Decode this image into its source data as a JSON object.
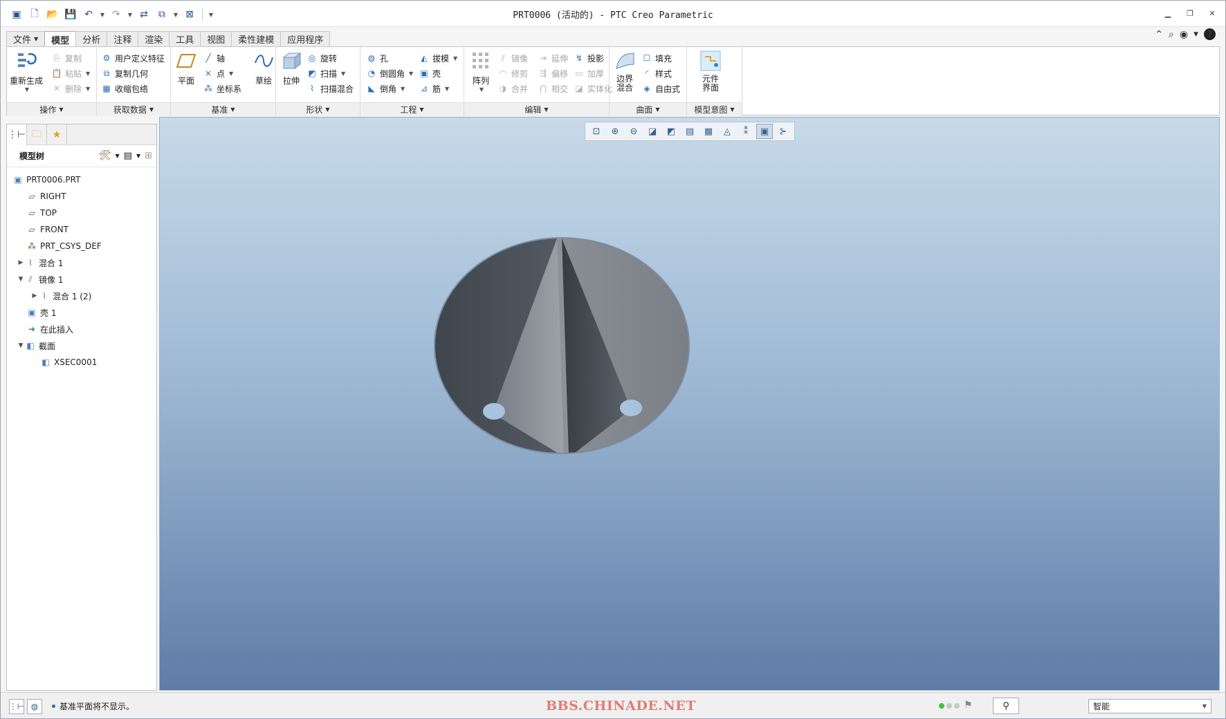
{
  "window": {
    "title": "PRT0006 (活动的) - PTC Creo Parametric"
  },
  "tabs": [
    {
      "label": "文件",
      "dropdown": true
    },
    {
      "label": "模型",
      "active": true
    },
    {
      "label": "分析"
    },
    {
      "label": "注释"
    },
    {
      "label": "渲染"
    },
    {
      "label": "工具"
    },
    {
      "label": "视图"
    },
    {
      "label": "柔性建模"
    },
    {
      "label": "应用程序"
    }
  ],
  "ribbon": {
    "operations": {
      "label": "操作",
      "regenerate": "重新生成",
      "copy": "复制",
      "paste": "粘贴",
      "delete": "删除"
    },
    "get_data": {
      "label": "获取数据",
      "udf": "用户定义特征",
      "copy_geom": "复制几何",
      "shrinkwrap": "收缩包络"
    },
    "datum": {
      "label": "基准",
      "plane": "平面",
      "axis": "轴",
      "point": "点",
      "csys": "坐标系",
      "sketch": "草绘"
    },
    "shapes": {
      "label": "形状",
      "extrude": "拉伸",
      "revolve": "旋转",
      "sweep": "扫描",
      "swept_blend": "扫描混合"
    },
    "engineering": {
      "label": "工程",
      "hole": "孔",
      "round": "倒圆角",
      "chamfer": "倒角",
      "draft": "拔模",
      "shell": "壳",
      "rib": "筋"
    },
    "editing": {
      "label": "编辑",
      "pattern": "阵列",
      "mirror": "镜像",
      "trim": "修剪",
      "merge": "合并",
      "extend": "延伸",
      "offset": "偏移",
      "intersect": "相交",
      "project": "投影",
      "thicken": "加厚",
      "solidify": "实体化"
    },
    "surfaces": {
      "label": "曲面",
      "boundary_blend": "边界混合",
      "fill": "填充",
      "style": "样式",
      "freestyle": "自由式"
    },
    "design_intent": {
      "label": "模型意图",
      "component_interface": "元件界面"
    }
  },
  "model_tree": {
    "header": "模型树",
    "nodes": [
      {
        "label": "PRT0006.PRT",
        "icon": "part-icon"
      },
      {
        "label": "RIGHT",
        "icon": "datum-plane-icon"
      },
      {
        "label": "TOP",
        "icon": "datum-plane-icon"
      },
      {
        "label": "FRONT",
        "icon": "datum-plane-icon"
      },
      {
        "label": "PRT_CSYS_DEF",
        "icon": "csys-icon"
      },
      {
        "label": "混合 1",
        "icon": "blend-icon",
        "expand": "collapsed"
      },
      {
        "label": "镜像 1",
        "icon": "mirror-icon",
        "expand": "expanded"
      },
      {
        "label": "混合 1 (2)",
        "icon": "blend-icon",
        "expand": "collapsed"
      },
      {
        "label": "壳 1",
        "icon": "shell-icon"
      },
      {
        "label": "在此插入",
        "icon": "insert-here-icon"
      },
      {
        "label": "截面",
        "icon": "section-icon",
        "expand": "expanded"
      },
      {
        "label": "XSEC0001",
        "icon": "xsec-icon"
      }
    ]
  },
  "status": {
    "message": "基准平面将不显示。",
    "watermark": "BBS.CHINADE.NET",
    "filter": "智能"
  },
  "colors": {
    "viewport_top": "#c6dae9",
    "viewport_bottom": "#5f7ca8",
    "watermark": "#e27c74",
    "accent": "#2d6cb3"
  }
}
